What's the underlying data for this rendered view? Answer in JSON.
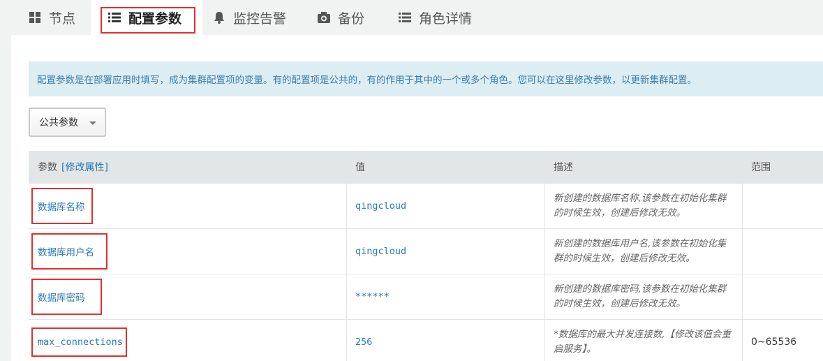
{
  "tabs": [
    {
      "label": "节点",
      "icon": "grid-icon"
    },
    {
      "label": "配置参数",
      "icon": "list-icon"
    },
    {
      "label": "监控告警",
      "icon": "bell-icon"
    },
    {
      "label": "备份",
      "icon": "camera-icon"
    },
    {
      "label": "角色详情",
      "icon": "list-icon"
    }
  ],
  "info_text": "配置参数是在部署应用时填写，成为集群配置项的变量。有的配置项是公共的，有的作用于其中的一个或多个角色。您可以在这里修改参数，以更新集群配置。",
  "dropdown": {
    "selected": "公共参数"
  },
  "table": {
    "headers": {
      "param": "参数",
      "modify_link": "[修改属性]",
      "value": "值",
      "desc": "描述",
      "range": "范围"
    },
    "rows": [
      {
        "name": "数据库名称",
        "value": "qingcloud",
        "desc": "新创建的数据库名称,该参数在初始化集群的时候生效，创建后修改无效。",
        "range": ""
      },
      {
        "name": "数据库用户名",
        "value": "qingcloud",
        "desc": "新创建的数据库用户名,该参数在初始化集群的时候生效，创建后修改无效。",
        "range": ""
      },
      {
        "name": "数据库密码",
        "value": "******",
        "desc": "新创建的数据库密码,该参数在初始化集群的时候生效，创建后修改无效。",
        "range": ""
      },
      {
        "name": "max_connections",
        "value": "256",
        "desc": "*数据库的最大并发连接数,【修改该值会重启服务】。",
        "range": "0~65536"
      }
    ]
  },
  "colors": {
    "accent": "#2a7ab8",
    "highlight": "#e0302e",
    "info_bg": "#dcedf4"
  }
}
